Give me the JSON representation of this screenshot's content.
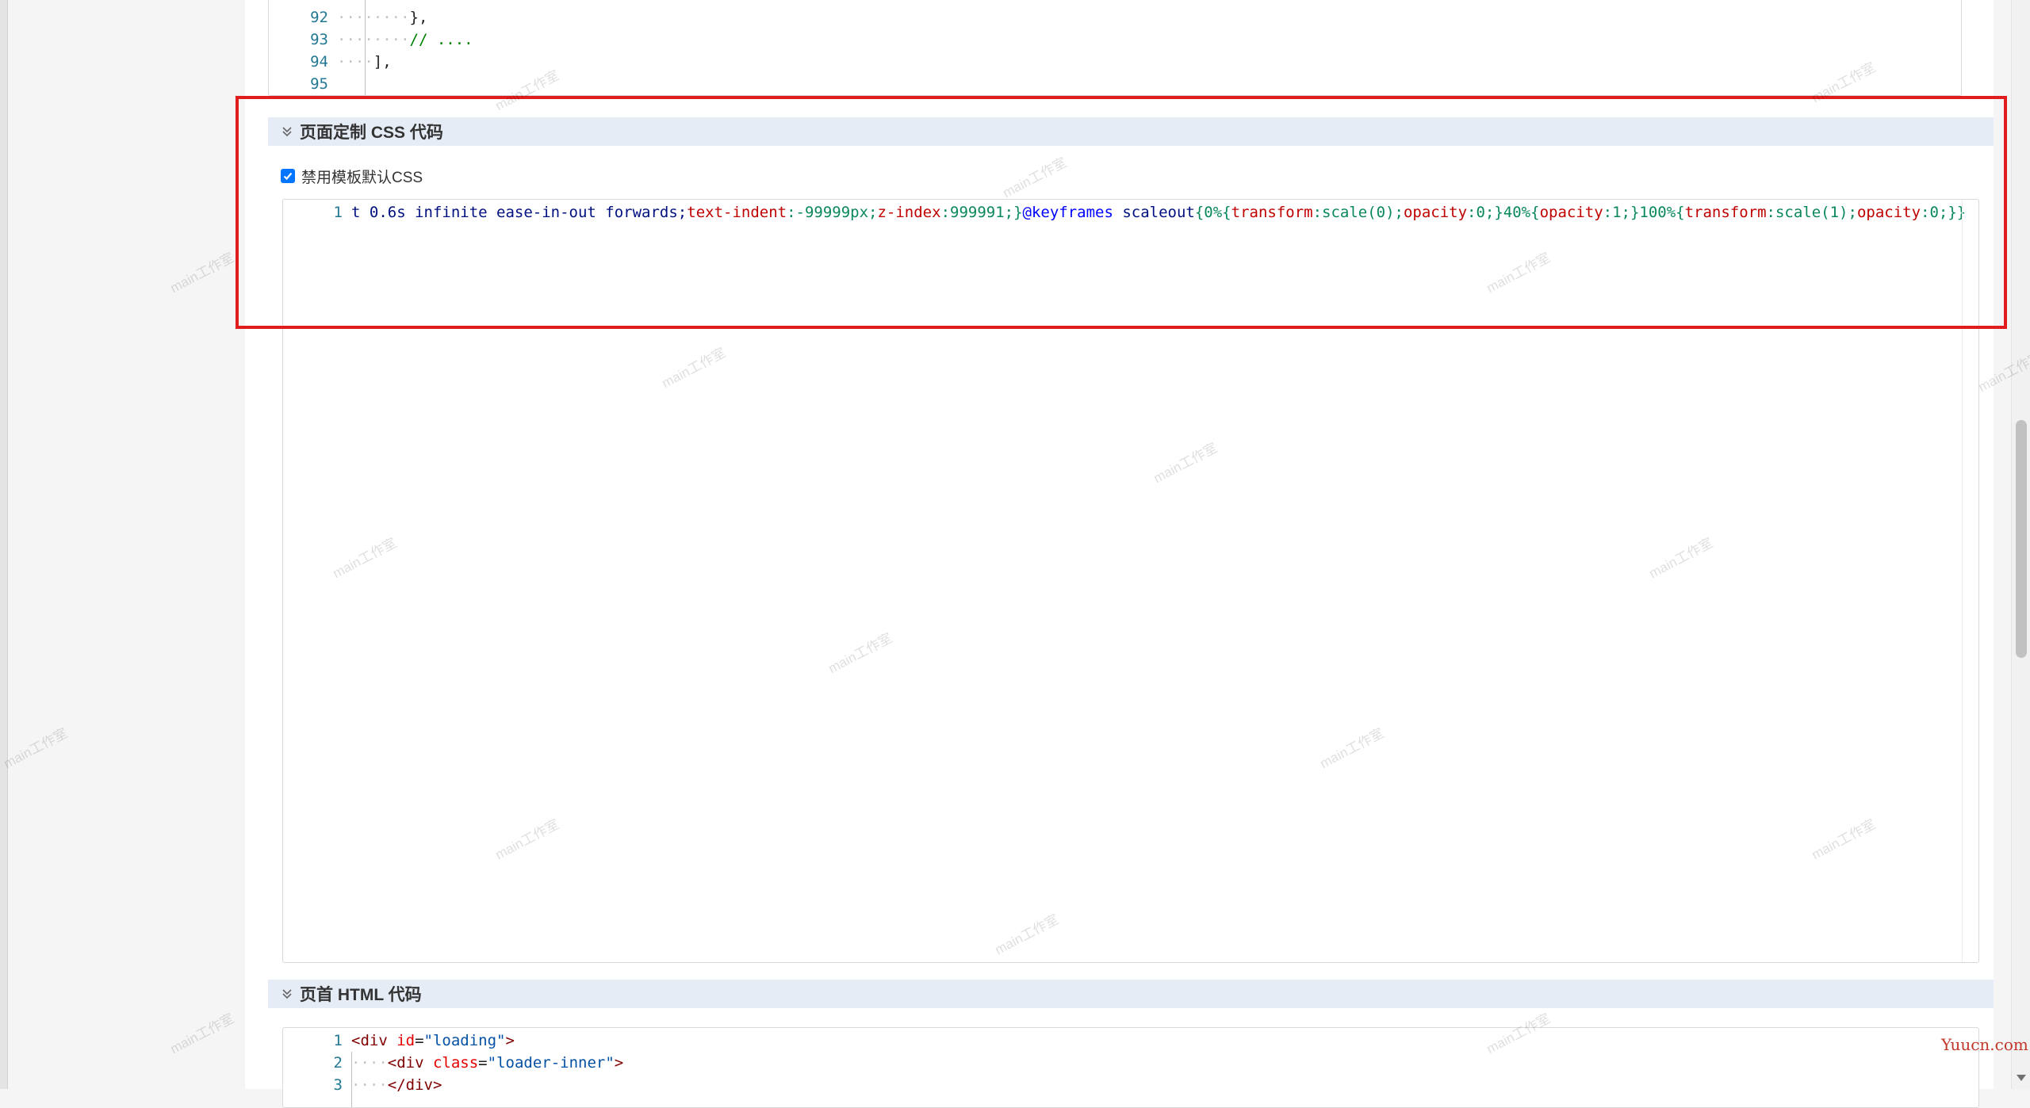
{
  "top_editor": {
    "lines": [
      {
        "n": "92",
        "text": "},"
      },
      {
        "n": "93",
        "text": "// ...."
      },
      {
        "n": "94",
        "text": "],"
      },
      {
        "n": "95",
        "text": ""
      }
    ]
  },
  "css_section": {
    "title": "页面定制 CSS 代码",
    "checkbox_label": "禁用模板默认CSS",
    "checkbox_checked": true,
    "line_number": "1",
    "code_tokens": [
      {
        "t": "t 0.6s infinite ease-in-out forwards;",
        "c": "c-ident"
      },
      {
        "t": "text-indent",
        "c": "c-red"
      },
      {
        "t": ":-99999px;",
        "c": "c-teal"
      },
      {
        "t": "z-index",
        "c": "c-red"
      },
      {
        "t": ":999991;}",
        "c": "c-teal"
      },
      {
        "t": "@keyframes",
        "c": "c-kw"
      },
      {
        "t": " scaleout",
        "c": "c-ident"
      },
      {
        "t": "{0%{",
        "c": "c-teal"
      },
      {
        "t": "transform",
        "c": "c-red"
      },
      {
        "t": ":scale(0);",
        "c": "c-teal"
      },
      {
        "t": "opacity",
        "c": "c-red"
      },
      {
        "t": ":0;}40%{",
        "c": "c-teal"
      },
      {
        "t": "opacity",
        "c": "c-red"
      },
      {
        "t": ":1;}100%{",
        "c": "c-teal"
      },
      {
        "t": "transform",
        "c": "c-red"
      },
      {
        "t": ":scale(1);",
        "c": "c-teal"
      },
      {
        "t": "opacity",
        "c": "c-red"
      },
      {
        "t": ":0;}}",
        "c": "c-teal"
      }
    ]
  },
  "html_section": {
    "title": "页首 HTML 代码",
    "lines": [
      {
        "n": "1",
        "indent": "",
        "parts": [
          {
            "t": "<div ",
            "c": "c-tag"
          },
          {
            "t": "id",
            "c": "c-attr"
          },
          {
            "t": "=",
            "c": "c-dark"
          },
          {
            "t": "\"loading\"",
            "c": "c-str"
          },
          {
            "t": ">",
            "c": "c-tag"
          }
        ]
      },
      {
        "n": "2",
        "indent": "····",
        "parts": [
          {
            "t": "<div ",
            "c": "c-tag"
          },
          {
            "t": "class",
            "c": "c-attr"
          },
          {
            "t": "=",
            "c": "c-dark"
          },
          {
            "t": "\"loader-inner\"",
            "c": "c-str"
          },
          {
            "t": ">",
            "c": "c-tag"
          }
        ]
      },
      {
        "n": "3",
        "indent": "····",
        "parts": [
          {
            "t": "</div>",
            "c": "c-tag"
          }
        ]
      }
    ]
  },
  "watermark_text": "main工作室",
  "site_mark": "Yuucn.com",
  "icons": {
    "section_toggle": "double-chevron-down-icon",
    "checkbox": "checkmark-icon"
  }
}
